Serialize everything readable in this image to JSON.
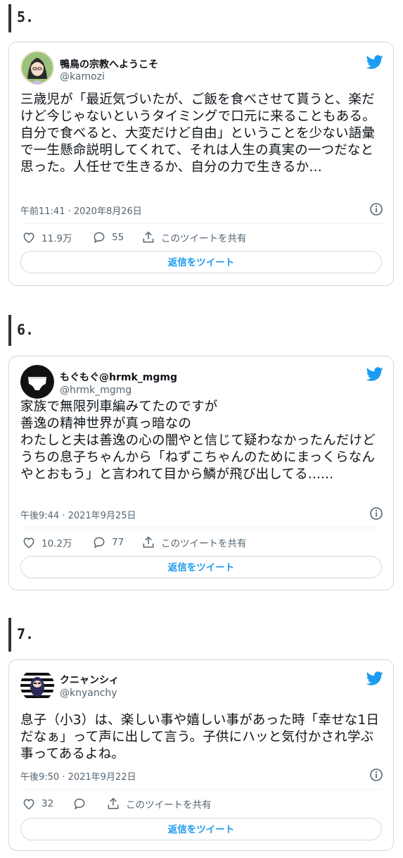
{
  "accent_color": "#1d9bf0",
  "reply_label": "返信をツイート",
  "share_label": "このツイートを共有",
  "items": [
    {
      "number": "5.",
      "name": "鴨鳥の宗教へようこそ",
      "handle": "@kamozi",
      "text": "三歳児が「最近気づいたが、ご飯を食べさせて貰うと、楽だけど今じゃないというタイミングで口元に来ることもある。自分で食べると、大変だけど自由」ということを少ない語彙で一生懸命説明してくれて、それは人生の真実の一つだなと思った。人任せで生きるか、自分の力で生きるか…",
      "timestamp": "午前11:41 · 2020年8月26日",
      "likes": "11.9万",
      "replies": "55",
      "avatar_icon": "anime-girl-avatar"
    },
    {
      "number": "6.",
      "name": "もぐもぐ@hrmk_mgmg",
      "handle": "@hrmk_mgmg",
      "text": "家族で無限列車編みてたのですが\n善逸の精神世界が真っ暗なの\nわたしと夫は善逸の心の闇やと信じて疑わなかったんだけど\nうちの息子ちゃんから「ねずこちゃんのためにまっくらなんやとおもう」と言われて目から鱗が飛び出してる......",
      "timestamp": "午後9:44 · 2021年9月25日",
      "likes": "10.2万",
      "replies": "77",
      "avatar_icon": "underwear-avatar"
    },
    {
      "number": "7.",
      "name": "クニャンシィ",
      "handle": "@knyanchy",
      "text": "息子（小3）は、楽しい事や嬉しい事があった時「幸せな1日だなぁ」って声に出して言う。子供にハッと気付かされ学ぶ事ってあるよね。",
      "timestamp": "午後9:50 · 2021年9月22日",
      "likes": "32",
      "replies": "",
      "avatar_icon": "striped-character-avatar"
    }
  ]
}
